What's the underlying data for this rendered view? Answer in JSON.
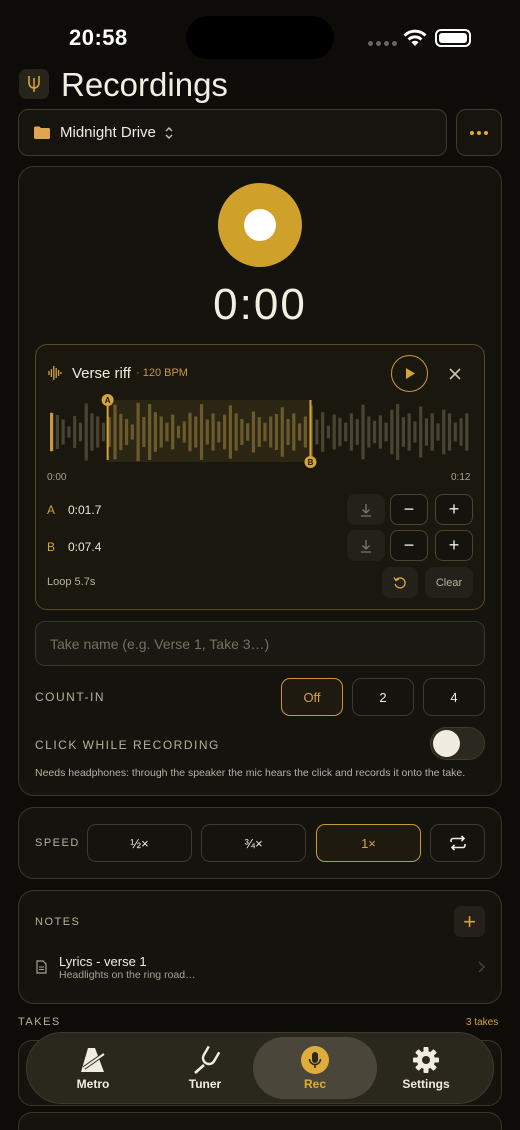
{
  "status_bar": {
    "time": "20:58"
  },
  "header": {
    "title": "Recordings"
  },
  "project": {
    "name": "Midnight Drive"
  },
  "recorder": {
    "timer": "0:00"
  },
  "clip": {
    "name": "Verse riff",
    "bpm": "· 120 BPM",
    "start_time": "0:00",
    "end_time": "0:12",
    "marker_a": {
      "label": "A",
      "value": "0:01.7"
    },
    "marker_b": {
      "label": "B",
      "value": "0:07.4"
    },
    "loop_label": "Loop 5.7s",
    "clear_label": "Clear",
    "minus_label": "−",
    "plus_label": "+",
    "waveform_levels": [
      0.62,
      0.55,
      0.4,
      0.18,
      0.52,
      0.3,
      0.92,
      0.6,
      0.5,
      0.3,
      0.48,
      0.88,
      0.58,
      0.42,
      0.24,
      0.94,
      0.48,
      0.9,
      0.64,
      0.5,
      0.3,
      0.56,
      0.2,
      0.34,
      0.62,
      0.5,
      0.9,
      0.4,
      0.6,
      0.34,
      0.56,
      0.86,
      0.6,
      0.42,
      0.28,
      0.66,
      0.48,
      0.3,
      0.5,
      0.58,
      0.8,
      0.42,
      0.6,
      0.28,
      0.5,
      0.86,
      0.4,
      0.64,
      0.2,
      0.56,
      0.46,
      0.3,
      0.6,
      0.42,
      0.88,
      0.5,
      0.36,
      0.54,
      0.3,
      0.72,
      0.9,
      0.48,
      0.6,
      0.34,
      0.82,
      0.44,
      0.6,
      0.28,
      0.72,
      0.6,
      0.3,
      0.44,
      0.6
    ],
    "loop_start_fraction": 0.142,
    "loop_end_fraction": 0.617
  },
  "take_name": {
    "placeholder": "Take name (e.g. Verse 1, Take 3…)"
  },
  "count_in": {
    "label": "COUNT-IN",
    "options": [
      "Off",
      "2",
      "4"
    ],
    "selected": "Off"
  },
  "click": {
    "label": "CLICK WHILE RECORDING",
    "enabled": false,
    "helper": "Needs headphones: through the speaker the mic hears the click and records it onto the take."
  },
  "speed": {
    "label": "SPEED",
    "options": [
      "½×",
      "¾×",
      "1×"
    ],
    "selected": "1×"
  },
  "notes": {
    "label": "NOTES",
    "add_label": "+",
    "items": [
      {
        "title": "Lyrics - verse 1",
        "subtitle": "Headlights on the ring road…"
      }
    ]
  },
  "takes": {
    "label": "TAKES",
    "count": "3 takes"
  },
  "tabbar": {
    "items": [
      {
        "label": "Metro",
        "icon": "metronome-icon"
      },
      {
        "label": "Tuner",
        "icon": "tuning-fork-icon"
      },
      {
        "label": "Rec",
        "icon": "microphone-icon"
      },
      {
        "label": "Settings",
        "icon": "gear-icon"
      }
    ],
    "active": "Rec"
  },
  "colors": {
    "accent": "#cfa02a",
    "background": "#0d0c09",
    "card": "#14130e"
  }
}
